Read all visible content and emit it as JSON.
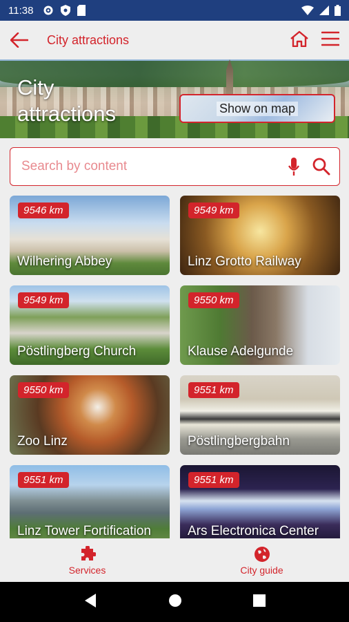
{
  "status_bar": {
    "time": "11:38"
  },
  "appbar": {
    "title": "City attractions"
  },
  "hero": {
    "title": "City attractions",
    "map_button": "Show on map"
  },
  "search": {
    "placeholder": "Search by content"
  },
  "cards": [
    {
      "name": "Wilhering Abbey",
      "distance": "9546 km"
    },
    {
      "name": "Linz Grotto Railway",
      "distance": "9549 km"
    },
    {
      "name": "Pöstlingberg Church",
      "distance": "9549 km"
    },
    {
      "name": "Klause Adelgunde",
      "distance": "9550 km"
    },
    {
      "name": "Zoo Linz",
      "distance": "9550 km"
    },
    {
      "name": "Pöstlingbergbahn",
      "distance": "9551 km"
    },
    {
      "name": "Linz Tower Fortification",
      "distance": "9551 km"
    },
    {
      "name": "Ars Electronica Center",
      "distance": "9551 km"
    }
  ],
  "bottom_nav": {
    "services": "Services",
    "city_guide": "City guide"
  },
  "colors": {
    "accent": "#d3242b",
    "status_bar": "#1f3f7f",
    "background": "#eeeeee"
  }
}
